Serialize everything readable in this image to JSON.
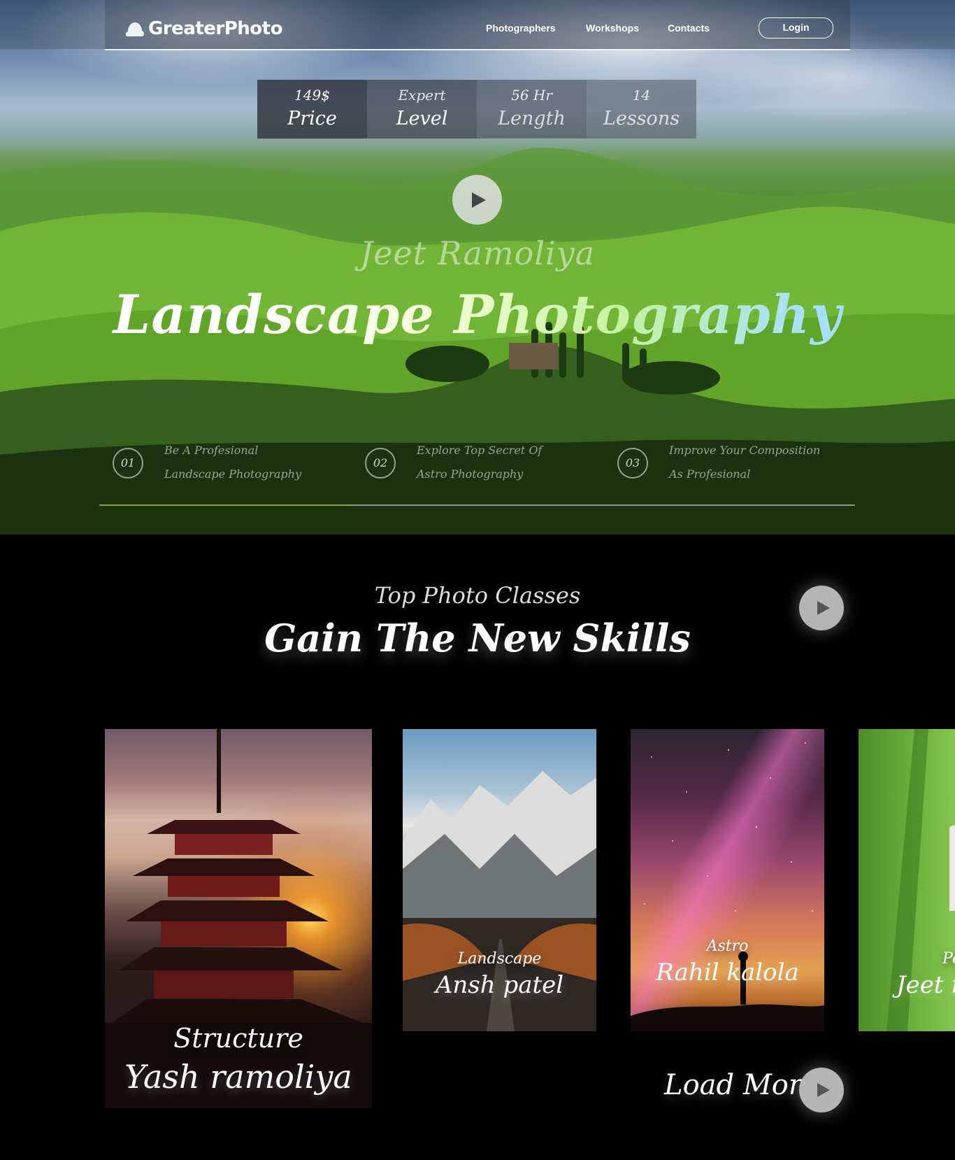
{
  "nav": {
    "logo_text": "GreaterPhoto",
    "links": [
      "Photographers",
      "Workshops",
      "Contacts"
    ],
    "login_label": "Login"
  },
  "hero": {
    "stats": [
      {
        "value": "149$",
        "label": "Price"
      },
      {
        "value": "Expert",
        "label": "Level"
      },
      {
        "value": "56 Hr",
        "label": "Length"
      },
      {
        "value": "14",
        "label": "Lessons"
      }
    ],
    "author": "Jeet Ramoliya",
    "title": "Landscape Photography",
    "features": [
      {
        "num": "01",
        "line1": "Be A Profesional",
        "line2": "Landscape Photography"
      },
      {
        "num": "02",
        "line1": "Explore Top Secret Of",
        "line2": "Astro Photography"
      },
      {
        "num": "03",
        "line1": "Improve Your Composition",
        "line2": "As Profesional"
      }
    ],
    "progress_fraction": 0.33
  },
  "classes": {
    "subtitle": "Top Photo Classes",
    "title": "Gain The New Skills",
    "cards": [
      {
        "category": "Structure",
        "name": "Yash ramoliya"
      },
      {
        "category": "Landscape",
        "name": "Ansh patel"
      },
      {
        "category": "Astro",
        "name": "Rahil kalola"
      },
      {
        "category": "Pe",
        "name": "Jeet ra"
      }
    ],
    "load_more": "Load More"
  },
  "icons": {
    "logo": "cloud-icon",
    "play": "play-icon"
  },
  "colors": {
    "progress": "#8fa12c",
    "page_bg": "#000000"
  }
}
